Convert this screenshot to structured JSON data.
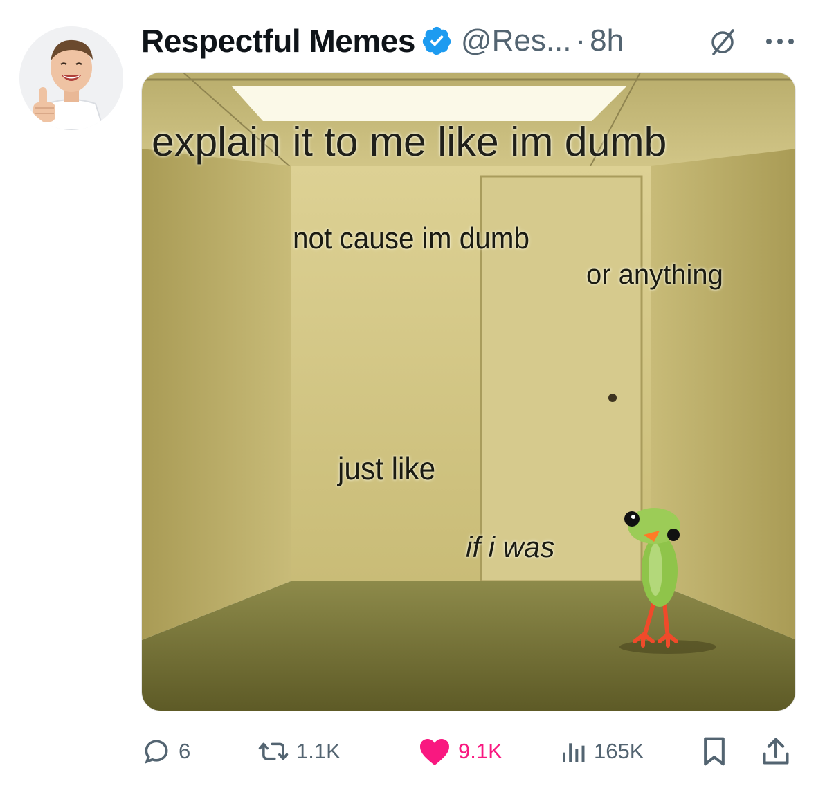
{
  "post": {
    "author_name": "Respectful Memes",
    "handle": "@Res...",
    "separator": "·",
    "time": "8h",
    "verified": true,
    "avatar_icon": "thumbs-up-man-avatar"
  },
  "meme": {
    "caption_top": "explain it to me like im dumb",
    "line_1": "not cause im dumb",
    "line_2": "or anything",
    "line_3": "just like",
    "line_4": "if i was",
    "scene": "yellow backrooms room with a door and a green frog-bird creature"
  },
  "actions": {
    "replies": "6",
    "reposts": "1.1K",
    "likes": "9.1K",
    "views": "165K",
    "liked": true
  },
  "colors": {
    "verified_blue": "#1d9bf0",
    "like_pink": "#f91880",
    "muted_gray": "#536471",
    "wall_yellow": "#cfc27e"
  }
}
